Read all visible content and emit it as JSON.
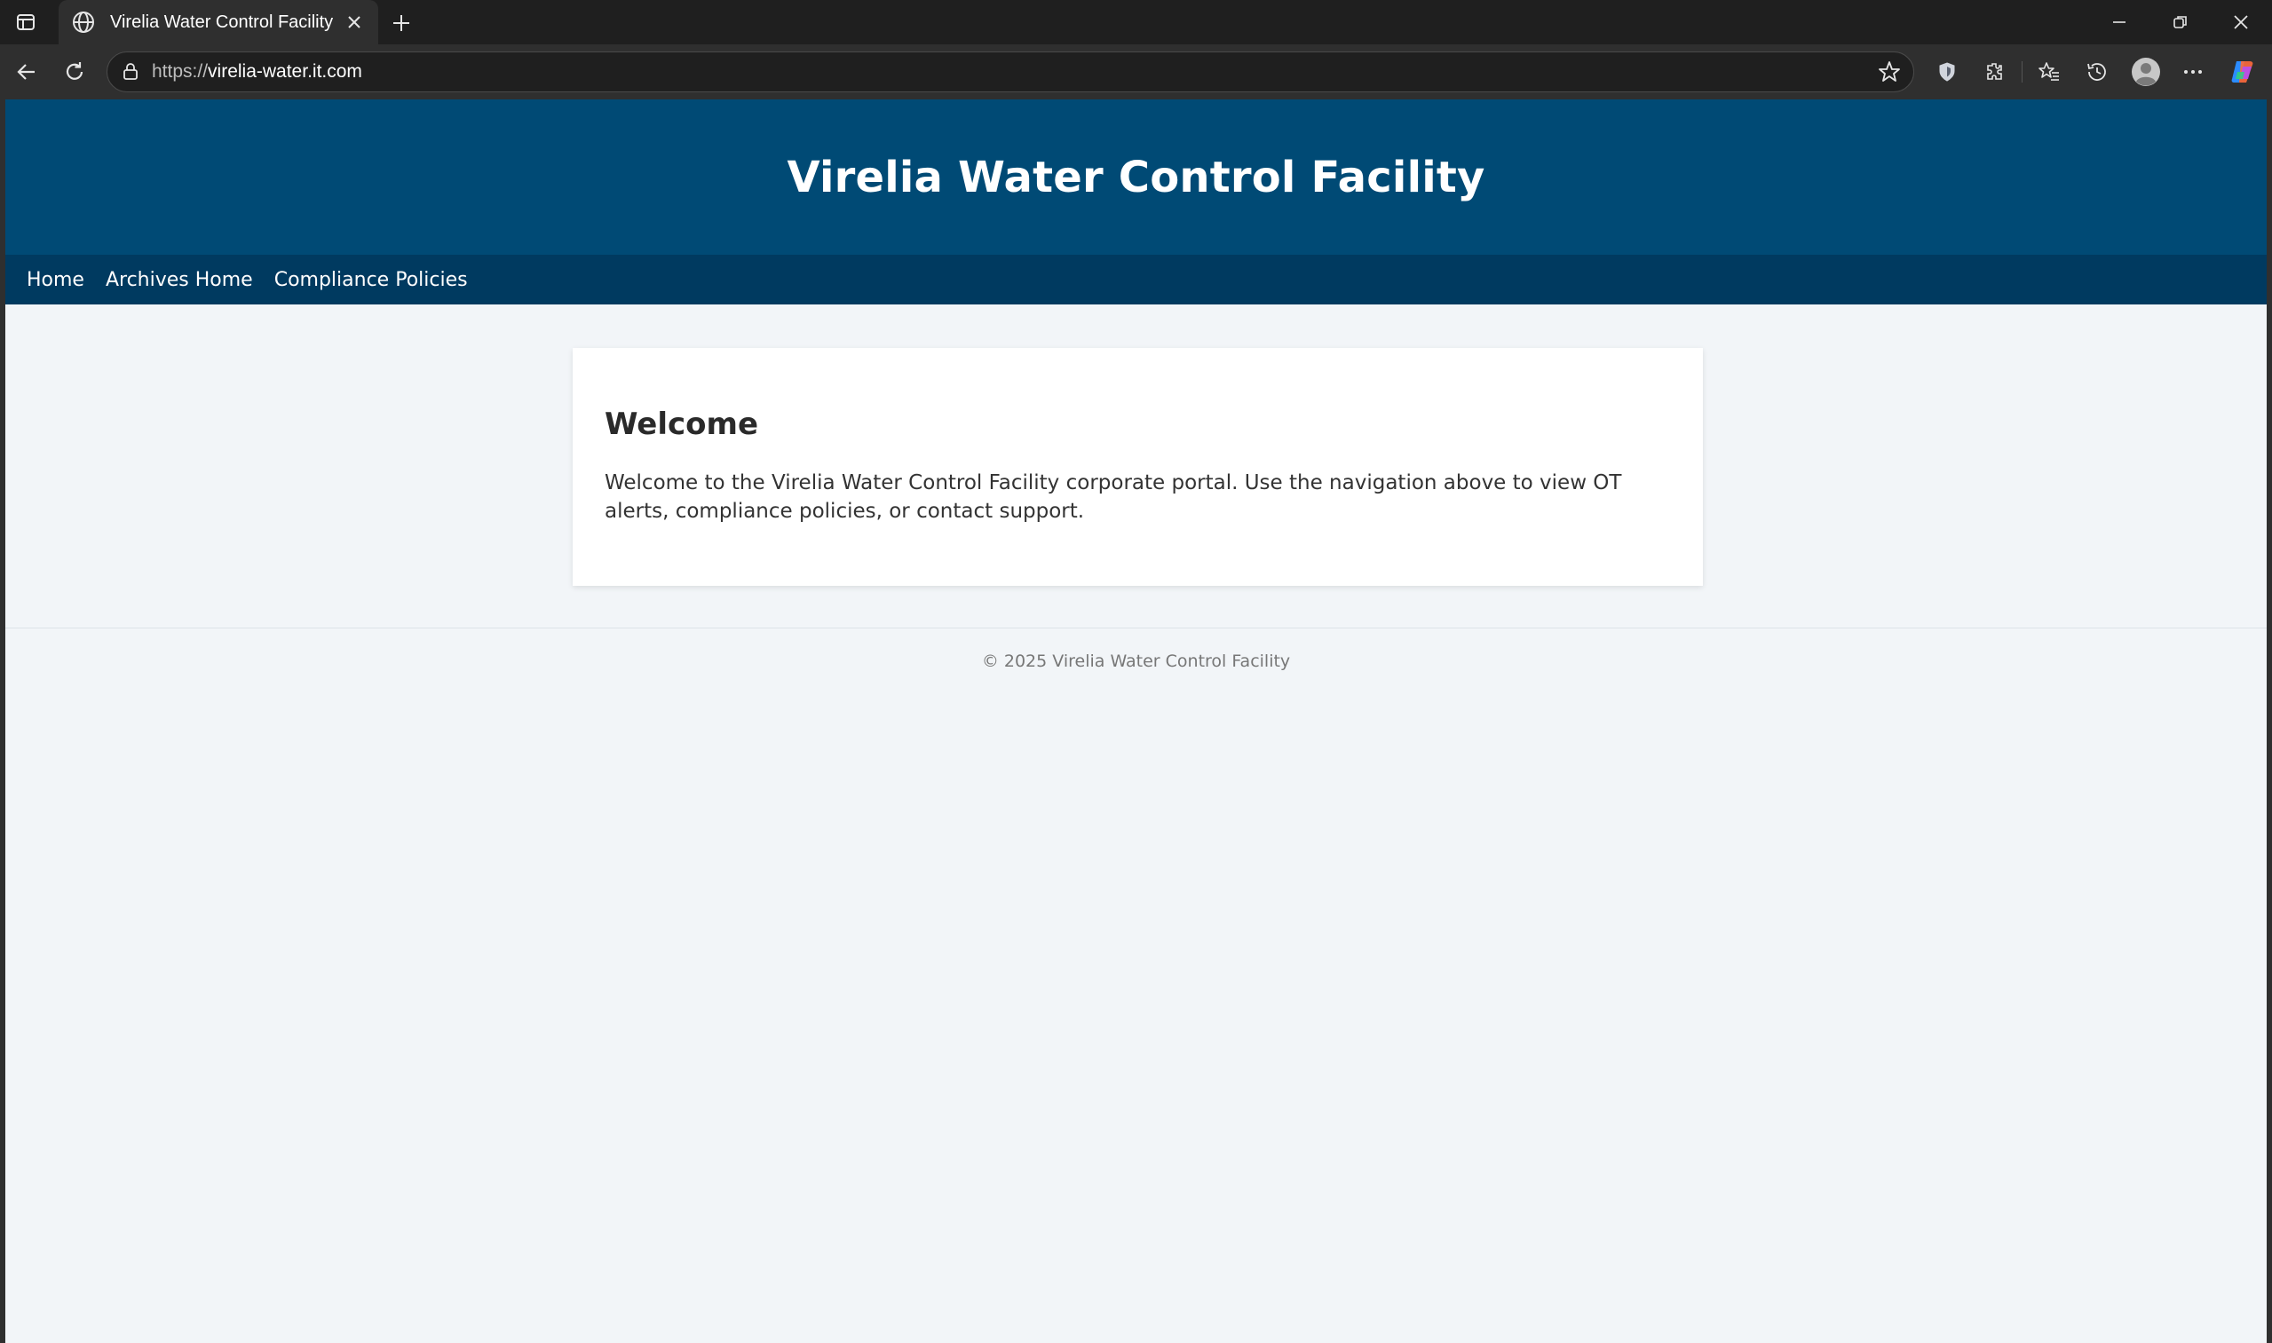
{
  "browser": {
    "tab_title": "Virelia Water Control Facility",
    "url_scheme": "https://",
    "url_host": "virelia-water.it.com",
    "icons": [
      "tab-actions-icon",
      "globe-icon",
      "close-icon",
      "plus-icon",
      "minimize-icon",
      "restore-icon",
      "window-close-icon",
      "back-icon",
      "refresh-icon",
      "lock-icon",
      "star-icon",
      "shield-icon",
      "extensions-icon",
      "favorites-icon",
      "history-icon",
      "profile-icon",
      "more-icon",
      "copilot-icon"
    ]
  },
  "site": {
    "title": "Virelia Water Control Facility",
    "nav": [
      "Home",
      "Archives Home",
      "Compliance Policies"
    ],
    "card": {
      "heading": "Welcome",
      "body": "Welcome to the Virelia Water Control Facility corporate portal. Use the navigation above to view OT alerts, compliance policies, or contact support."
    },
    "footer": "© 2025 Virelia Water Control Facility"
  },
  "colors": {
    "header_bg": "#004a75",
    "nav_bg": "#003a60",
    "page_bg": "#f2f5f8",
    "card_bg": "#ffffff",
    "browser_dark": "#1f1f1f",
    "browser_toolbar": "#2f2f2f"
  }
}
